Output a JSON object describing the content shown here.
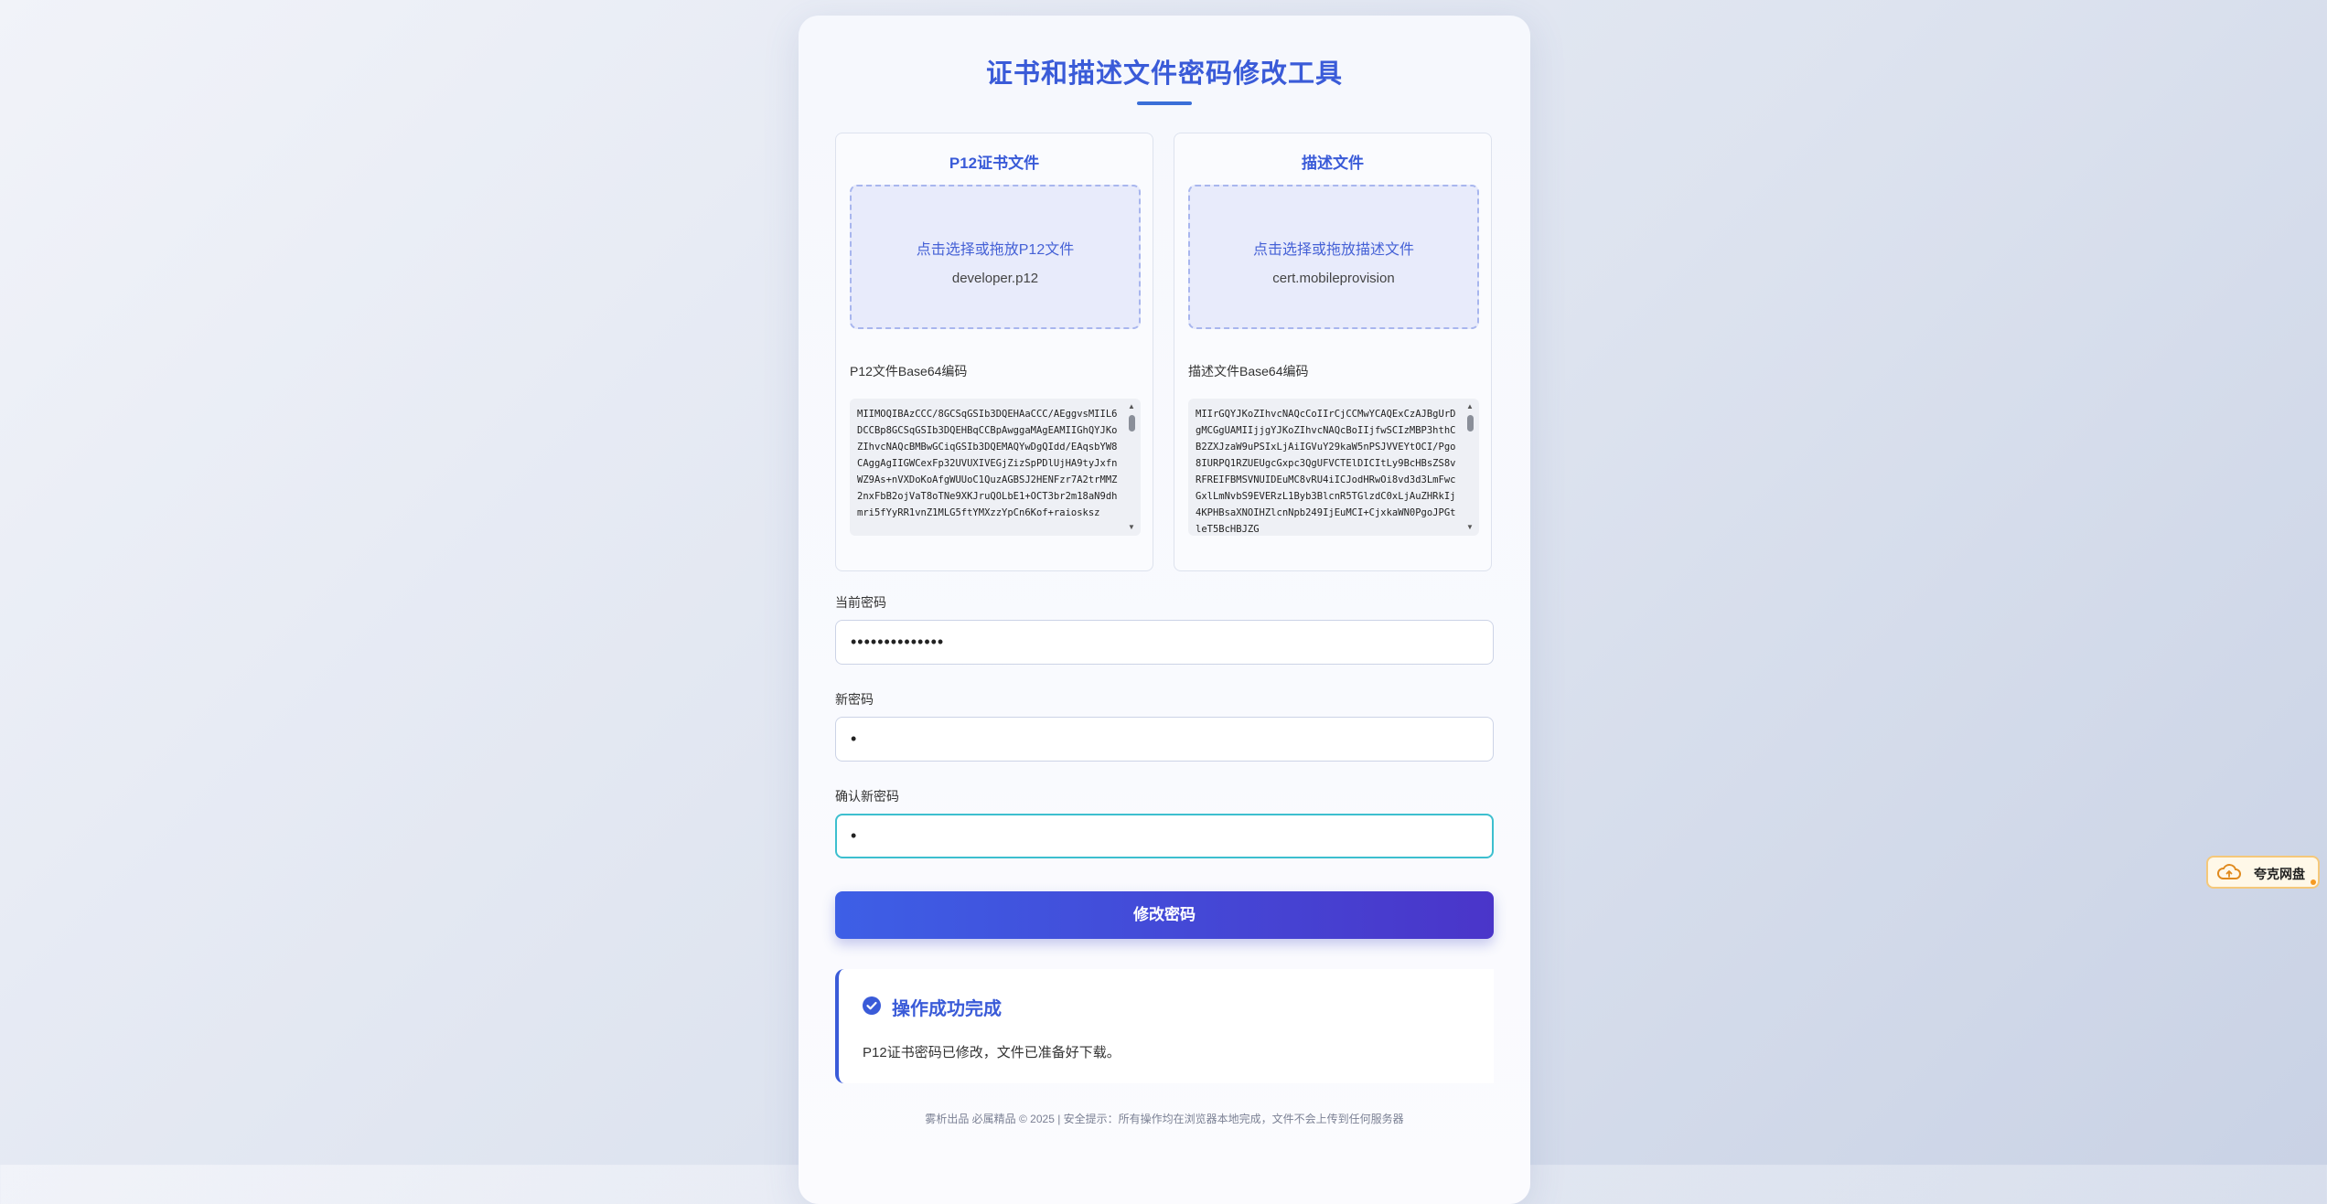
{
  "title": "证书和描述文件密码修改工具",
  "p12_panel": {
    "title": "P12证书文件",
    "dropzone_prompt": "点击选择或拖放P12文件",
    "file_name": "developer.p12",
    "base64_label": "P12文件Base64编码",
    "base64_value": "MIIMOQIBAzCCC/8GCSqGSIb3DQEHAaCCC/AEggvsMIIL6DCCBp8GCSqGSIb3DQEHBqCCBpAwggaMAgEAMIIGhQYJKoZIhvcNAQcBMBwGCiqGSIb3DQEMAQYwDgQIdd/EAqsbYW8CAggAgIIGWCexFp32UVUXIVEGjZizSpPDlUjHA9tyJxfnWZ9As+nVXDoKoAfgWUUoC1QuzAGBSJ2HENFzr7A2trMMZ2nxFbB2ojVaT8oTNe9XKJruQOLbE1+OCT3br2m18aN9dhmri5fYyRR1vnZ1MLG5ftYMXzzYpCn6Kof+raiosksz"
  },
  "profile_panel": {
    "title": "描述文件",
    "dropzone_prompt": "点击选择或拖放描述文件",
    "file_name": "cert.mobileprovision",
    "base64_label": "描述文件Base64编码",
    "base64_value": "MIIrGQYJKoZIhvcNAQcCoIIrCjCCMwYCAQExCzAJBgUrDgMCGgUAMIIjjgYJKoZIhvcNAQcBoIIjfwSCIzMBP3hthCB2ZXJzaW9uPSIxLjAiIGVuY29kaW5nPSJVVEYtOCI/Pgo8IURPQ1RZUEUgcGxpc3QgUFVCTElDICItLy9BcHBsZS8vRFREIFBMSVNUIDEuMC8vRU4iICJodHRwOi8vd3d3LmFwcGxlLmNvbS9EVERzL1Byb3BlcnR5TGlzdC0xLjAuZHRkIj4KPHBsaXNOIHZlcnNpb249IjEuMCI+CjxkaWN0PgoJPGtleT5BcHBJZG"
  },
  "current_password": {
    "label": "当前密码",
    "value": "••••••••••••••"
  },
  "new_password": {
    "label": "新密码",
    "value": "•"
  },
  "confirm_password": {
    "label": "确认新密码",
    "value": "•"
  },
  "submit_label": "修改密码",
  "result": {
    "title": "操作成功完成",
    "message": "P12证书密码已修改，文件已准备好下载。"
  },
  "footer": "雾析出品 必属精品 © 2025 | 安全提示：所有操作均在浏览器本地完成，文件不会上传到任何服务器",
  "widget": {
    "label": "夸克网盘"
  },
  "colors": {
    "accent": "#3a5bd8",
    "button_start": "#3d5fe6",
    "button_end": "#4a35c9",
    "focus_border": "#3dbfcf",
    "dropzone_bg": "#e8ebfb"
  }
}
